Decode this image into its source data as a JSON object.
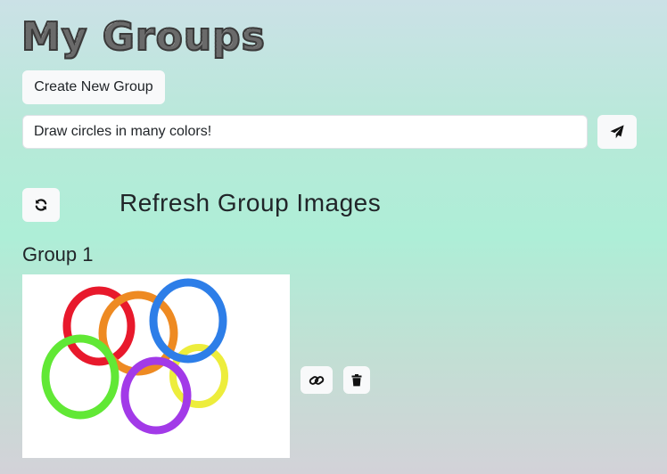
{
  "header": {
    "title": "My Groups"
  },
  "actions": {
    "create_group_label": "Create New Group"
  },
  "prompt": {
    "value": "Draw circles in many colors!",
    "send_icon": "paper-plane-icon"
  },
  "refresh": {
    "icon": "refresh-icon",
    "heading": "Refresh Group Images"
  },
  "groups": [
    {
      "title": "Group 1",
      "image": {
        "content": "colorful rings",
        "colors": [
          "#e8192c",
          "#ee8a22",
          "#2d7ee8",
          "#61e835",
          "#eded3c",
          "#a23ae8"
        ]
      },
      "actions": {
        "link_icon": "link-icon",
        "delete_icon": "trash-icon"
      }
    }
  ],
  "colors": {
    "button_bg": "#f8f9fa",
    "text": "#212529"
  }
}
